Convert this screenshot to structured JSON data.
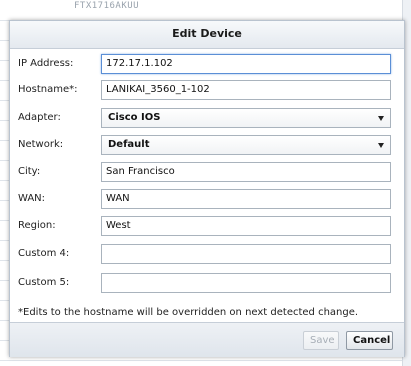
{
  "background": {
    "header_text": "FTX1716AKUU"
  },
  "dialog": {
    "title": "Edit Device",
    "fields": [
      {
        "label": "IP Address:",
        "value": "172.17.1.102",
        "type": "text"
      },
      {
        "label": "Hostname*:",
        "value": "LANIKAI_3560_1-102",
        "type": "text"
      },
      {
        "label": "Adapter:",
        "value": "Cisco IOS",
        "type": "select"
      },
      {
        "label": "Network:",
        "value": "Default",
        "type": "select"
      },
      {
        "label": "City:",
        "value": "San Francisco",
        "type": "text"
      },
      {
        "label": "WAN:",
        "value": "WAN",
        "type": "text"
      },
      {
        "label": "Region:",
        "value": "West",
        "type": "text"
      },
      {
        "label": "Custom 4:",
        "value": "",
        "type": "text"
      },
      {
        "label": "Custom 5:",
        "value": "",
        "type": "text"
      }
    ],
    "note": "*Edits to the hostname will be overridden on next detected change.",
    "buttons": {
      "save_label": "Save",
      "cancel_label": "Cancel"
    }
  },
  "colors": {
    "focus_border": "#5b8fd6",
    "disabled_text": "#a7aeb6"
  },
  "icons": {
    "select_arrow": "chevron-down-icon"
  }
}
